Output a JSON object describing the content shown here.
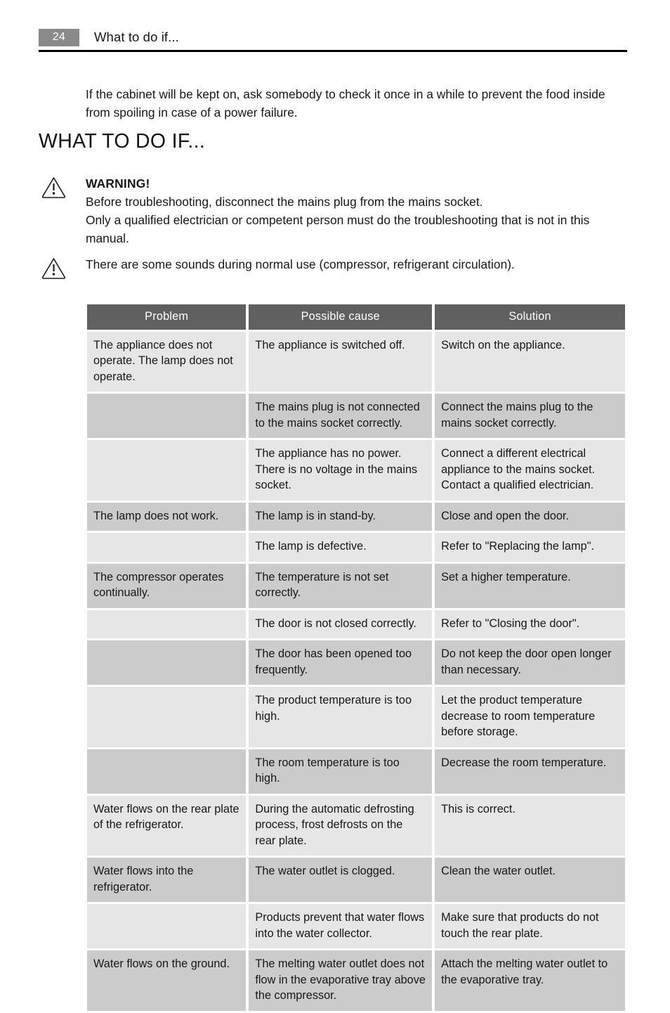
{
  "header": {
    "page_number": "24",
    "title": "What to do if..."
  },
  "intro": {
    "paragraph": "If the cabinet will be kept on, ask somebody to check it once in a while to prevent the food inside from spoiling in case of a power failure."
  },
  "section": {
    "heading": "WHAT TO DO IF..."
  },
  "notes": [
    {
      "icon": "warning-triangle-icon",
      "title": "WARNING!",
      "lines": [
        "Before troubleshooting, disconnect the mains plug from the mains socket.",
        "Only a qualified electrician or competent person must do the troubleshooting that is not in this manual."
      ]
    },
    {
      "icon": "caution-triangle-icon",
      "title": "",
      "lines": [
        "There are some sounds during normal use (compressor, refrigerant circulation)."
      ]
    }
  ],
  "table": {
    "headers": [
      "Problem",
      "Possible cause",
      "Solution"
    ],
    "rows": [
      {
        "problem": "The appliance does not operate. The lamp does not operate.",
        "cause": "The appliance is switched off.",
        "solution": "Switch on the appliance."
      },
      {
        "problem": "",
        "cause": "The mains plug is not connected to the mains socket correctly.",
        "solution": "Connect the mains plug to the mains socket correctly."
      },
      {
        "problem": "",
        "cause": "The appliance has no power. There is no voltage in the mains socket.",
        "solution": "Connect a different electrical appliance to the mains socket. Contact a qualified electrician."
      },
      {
        "problem": "The lamp does not work.",
        "cause": "The lamp is in stand-by.",
        "solution": "Close and open the door."
      },
      {
        "problem": "",
        "cause": "The lamp is defective.",
        "solution": "Refer to \"Replacing the lamp\"."
      },
      {
        "problem": "The compressor operates continually.",
        "cause": "The temperature is not set correctly.",
        "solution": "Set a higher temperature."
      },
      {
        "problem": "",
        "cause": "The door is not closed correctly.",
        "solution": "Refer to \"Closing the door\"."
      },
      {
        "problem": "",
        "cause": "The door has been opened too frequently.",
        "solution": "Do not keep the door open longer than necessary."
      },
      {
        "problem": "",
        "cause": "The product temperature is too high.",
        "solution": "Let the product temperature decrease to room temperature before storage."
      },
      {
        "problem": "",
        "cause": "The room temperature is too high.",
        "solution": "Decrease the room temperature."
      },
      {
        "problem": "Water flows on the rear plate of the refrigerator.",
        "cause": "During the automatic defrosting process, frost defrosts on the rear plate.",
        "solution": "This is correct."
      },
      {
        "problem": "Water flows into the refrigerator.",
        "cause": "The water outlet is clogged.",
        "solution": "Clean the water outlet."
      },
      {
        "problem": "",
        "cause": "Products prevent that water flows into the water collector.",
        "solution": "Make sure that products do not touch the rear plate."
      },
      {
        "problem": "Water flows on the ground.",
        "cause": "The melting water outlet does not flow in the evaporative tray above the compressor.",
        "solution": "Attach the melting water outlet to the evaporative tray."
      }
    ]
  },
  "colors": {
    "header_badge": "#8a8a8a",
    "table_header_bg": "#606060",
    "stripe_light": "#e6e6e6",
    "stripe_dark": "#cbcbcb",
    "text": "#171717"
  }
}
